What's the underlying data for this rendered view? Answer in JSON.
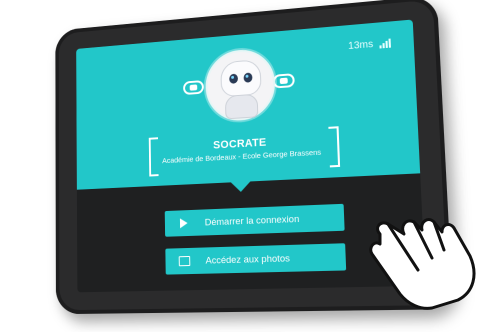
{
  "status": {
    "latency": "13ms"
  },
  "robot": {
    "name": "SOCRATE",
    "school": "Académie de Bordeaux - Ecole George Brassens"
  },
  "buttons": {
    "connect": "Démarrer la connexion",
    "photos": "Accédez aux photos"
  },
  "icons": {
    "connect": "play-icon",
    "photos": "photo-icon",
    "signal": "signal-icon",
    "left_pill": "toggle-icon",
    "right_pill": "toggle-icon",
    "hand": "pointing-hand-icon"
  },
  "colors": {
    "accent": "#22c7c9",
    "tablet": "#2b2b2c",
    "screen_bg": "#1f2021"
  }
}
